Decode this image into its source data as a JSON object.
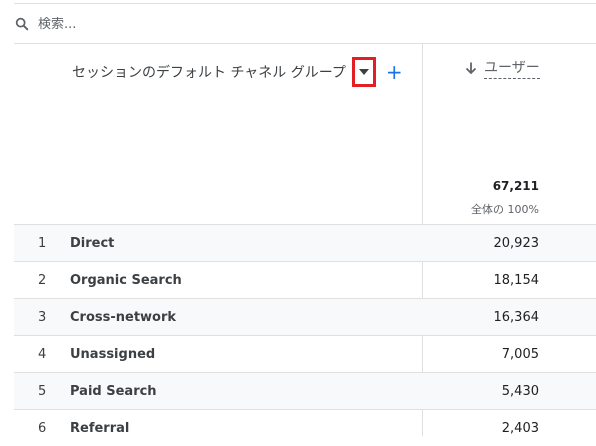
{
  "search": {
    "placeholder": "検索..."
  },
  "dimension": {
    "title": "セッションのデフォルト チャネル グループ",
    "add_symbol": "+"
  },
  "metric": {
    "label": "ユーザー",
    "total": "67,211",
    "total_pct": "全体の 100%"
  },
  "rows": [
    {
      "rank": "1",
      "channel": "Direct",
      "value": "20,923"
    },
    {
      "rank": "2",
      "channel": "Organic Search",
      "value": "18,154"
    },
    {
      "rank": "3",
      "channel": "Cross-network",
      "value": "16,364"
    },
    {
      "rank": "4",
      "channel": "Unassigned",
      "value": "7,005"
    },
    {
      "rank": "5",
      "channel": "Paid Search",
      "value": "5,430"
    },
    {
      "rank": "6",
      "channel": "Referral",
      "value": "2,403"
    }
  ]
}
